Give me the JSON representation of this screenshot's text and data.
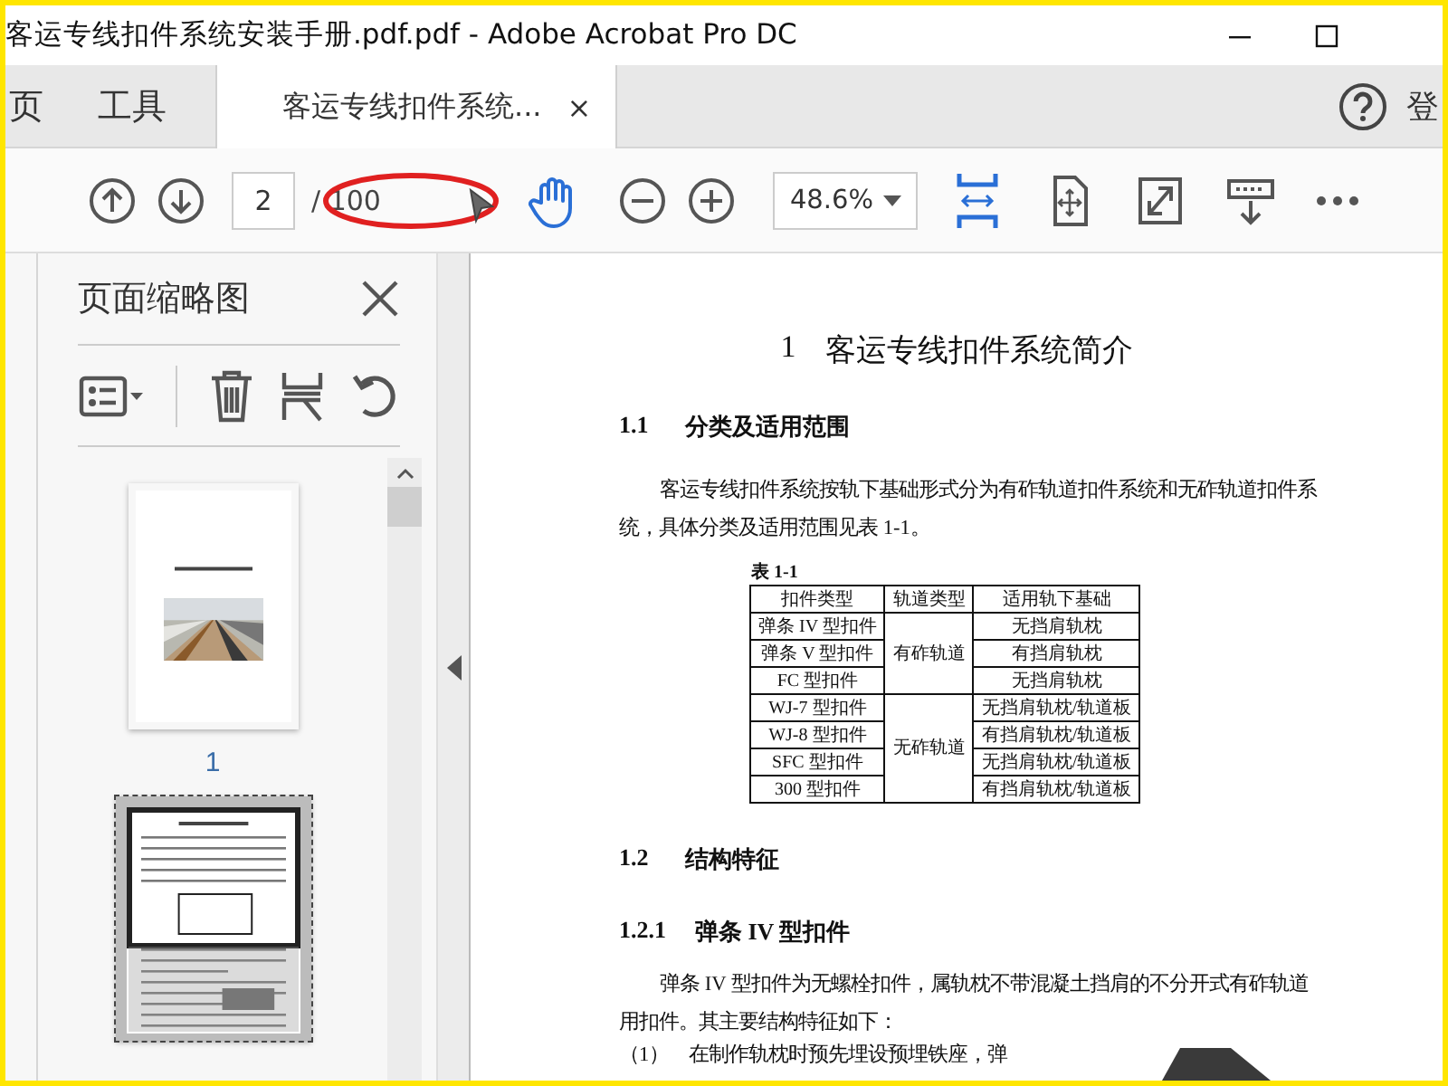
{
  "window": {
    "title": "客运专线扣件系统安装手册.pdf.pdf - Adobe Acrobat Pro DC"
  },
  "tabs": [
    {
      "label": "页",
      "kind": "nav",
      "selected": false
    },
    {
      "label": "工具",
      "kind": "nav",
      "selected": false
    },
    {
      "label": "客运专线扣件系统...",
      "kind": "document",
      "selected": true,
      "close": "×"
    }
  ],
  "account": {
    "label": "登"
  },
  "toolbar": {
    "page": "2",
    "page_total": "/ 100",
    "zoom": "48.6%"
  },
  "thumbnails_panel": {
    "title": "页面缩略图",
    "pages": [
      {
        "label": "1",
        "kind": "cover",
        "selected": false
      },
      {
        "kind": "content",
        "selected": true
      }
    ]
  },
  "document": {
    "blocks": [
      {
        "kind": "h1",
        "number": "1",
        "text": "客运专线扣件系统简介"
      },
      {
        "kind": "h2",
        "number": "1.1",
        "text": "分类及适用范围"
      },
      {
        "kind": "p",
        "text": "客运专线扣件系统按轨下基础形式分为有砟轨道扣件系统和无砟轨道扣件系统，具体分类及适用范围见表 1-1。"
      },
      {
        "kind": "table",
        "caption": "表 1-1",
        "columns": [
          "扣件类型",
          "轨道类型",
          "适用轨下基础"
        ],
        "groups": [
          {
            "track": "有砟轨道",
            "rows": [
              {
                "fastener": "弹条 IV 型扣件",
                "base": "无挡肩轨枕"
              },
              {
                "fastener": "弹条 V 型扣件",
                "base": "有挡肩轨枕"
              },
              {
                "fastener": "FC 型扣件",
                "base": "无挡肩轨枕"
              }
            ]
          },
          {
            "track": "无砟轨道",
            "rows": [
              {
                "fastener": "WJ-7 型扣件",
                "base": "无挡肩轨枕/轨道板"
              },
              {
                "fastener": "WJ-8 型扣件",
                "base": "有挡肩轨枕/轨道板"
              },
              {
                "fastener": "SFC 型扣件",
                "base": "无挡肩轨枕/轨道板"
              },
              {
                "fastener": "300 型扣件",
                "base": "有挡肩轨枕/轨道板"
              }
            ]
          }
        ]
      },
      {
        "kind": "h2",
        "number": "1.2",
        "text": "结构特征"
      },
      {
        "kind": "h3",
        "number": "1.2.1",
        "text": "弹条 IV 型扣件"
      },
      {
        "kind": "p",
        "text": "弹条 IV 型扣件为无螺栓扣件，属轨枕不带混凝土挡肩的不分开式有砟轨道用扣件。其主要结构特征如下："
      },
      {
        "kind": "li",
        "number": "（1）",
        "text": "在制作轨枕时预先埋设预埋铁座，弹"
      }
    ]
  }
}
